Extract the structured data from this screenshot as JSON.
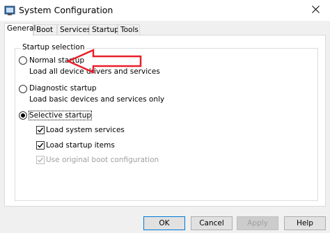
{
  "window": {
    "title": "System Configuration",
    "icons": {
      "app": "system-config-icon",
      "close": "close-icon"
    }
  },
  "tabs": [
    {
      "label": "General",
      "active": true
    },
    {
      "label": "Boot",
      "active": false
    },
    {
      "label": "Services",
      "active": false
    },
    {
      "label": "Startup",
      "active": false
    },
    {
      "label": "Tools",
      "active": false
    }
  ],
  "startup_selection": {
    "legend": "Startup selection",
    "options": [
      {
        "label": "Normal startup",
        "description": "Load all device drivers and services",
        "selected": false
      },
      {
        "label": "Diagnostic startup",
        "description": "Load basic devices and services only",
        "selected": false
      },
      {
        "label": "Selective startup",
        "description": "",
        "selected": true
      }
    ],
    "selective_items": [
      {
        "label": "Load system services",
        "checked": true,
        "enabled": true
      },
      {
        "label": "Load startup items",
        "checked": true,
        "enabled": true
      },
      {
        "label": "Use original boot configuration",
        "checked": true,
        "enabled": false
      }
    ]
  },
  "annotation": {
    "arrow_color": "#e8202a"
  },
  "buttons": {
    "ok": "OK",
    "cancel": "Cancel",
    "apply": "Apply",
    "help": "Help"
  }
}
